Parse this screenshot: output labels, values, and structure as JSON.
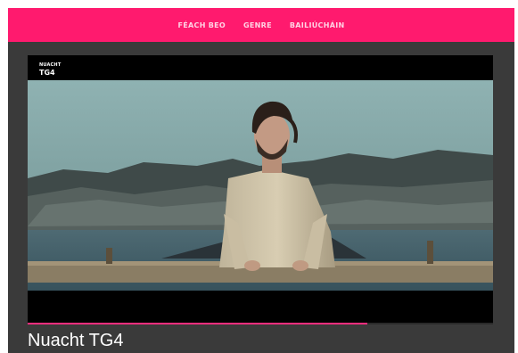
{
  "nav": {
    "items": [
      {
        "label": "FÉACH BEO"
      },
      {
        "label": "GENRE"
      },
      {
        "label": "BAILIÚCHÁIN"
      }
    ]
  },
  "player": {
    "logo_line1": "NUACHT",
    "logo_line2": "TG4",
    "progress": 0.73
  },
  "page_title": "Nuacht TG4",
  "colors": {
    "accent": "#ff1a6e",
    "background": "#3a3a3a"
  }
}
